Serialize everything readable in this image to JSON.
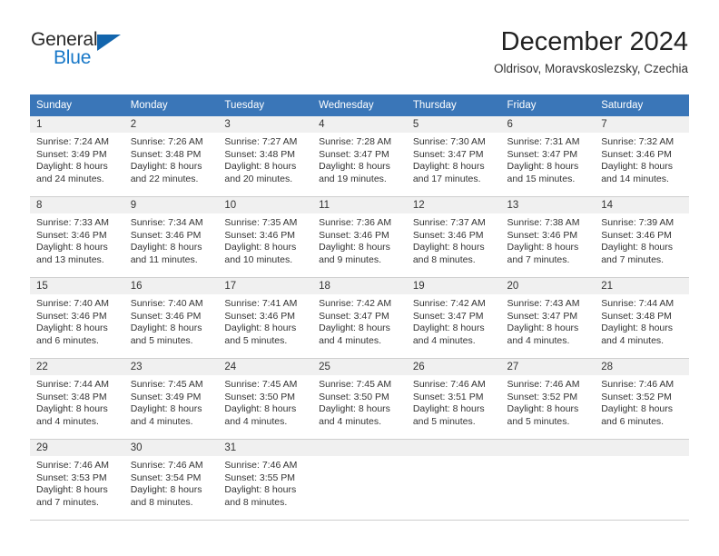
{
  "brand": {
    "name_part1": "General",
    "name_part2": "Blue",
    "triangle_color": "#1265ad",
    "blue_color": "#1878c8"
  },
  "header": {
    "title": "December 2024",
    "location": "Oldrisov, Moravskoslezsky, Czechia"
  },
  "theme": {
    "header_bg": "#3a76b8",
    "header_text": "#ffffff",
    "daynum_bg": "#f0f0f0",
    "body_text": "#333333",
    "border": "#cfcfcf"
  },
  "weekday_headers": [
    "Sunday",
    "Monday",
    "Tuesday",
    "Wednesday",
    "Thursday",
    "Friday",
    "Saturday"
  ],
  "labels": {
    "sunrise_prefix": "Sunrise:",
    "sunset_prefix": "Sunset:",
    "daylight_prefix": "Daylight:"
  },
  "weeks": [
    [
      {
        "day": "1",
        "sunrise": "Sunrise: 7:24 AM",
        "sunset": "Sunset: 3:49 PM",
        "daylight1": "Daylight: 8 hours",
        "daylight2": "and 24 minutes."
      },
      {
        "day": "2",
        "sunrise": "Sunrise: 7:26 AM",
        "sunset": "Sunset: 3:48 PM",
        "daylight1": "Daylight: 8 hours",
        "daylight2": "and 22 minutes."
      },
      {
        "day": "3",
        "sunrise": "Sunrise: 7:27 AM",
        "sunset": "Sunset: 3:48 PM",
        "daylight1": "Daylight: 8 hours",
        "daylight2": "and 20 minutes."
      },
      {
        "day": "4",
        "sunrise": "Sunrise: 7:28 AM",
        "sunset": "Sunset: 3:47 PM",
        "daylight1": "Daylight: 8 hours",
        "daylight2": "and 19 minutes."
      },
      {
        "day": "5",
        "sunrise": "Sunrise: 7:30 AM",
        "sunset": "Sunset: 3:47 PM",
        "daylight1": "Daylight: 8 hours",
        "daylight2": "and 17 minutes."
      },
      {
        "day": "6",
        "sunrise": "Sunrise: 7:31 AM",
        "sunset": "Sunset: 3:47 PM",
        "daylight1": "Daylight: 8 hours",
        "daylight2": "and 15 minutes."
      },
      {
        "day": "7",
        "sunrise": "Sunrise: 7:32 AM",
        "sunset": "Sunset: 3:46 PM",
        "daylight1": "Daylight: 8 hours",
        "daylight2": "and 14 minutes."
      }
    ],
    [
      {
        "day": "8",
        "sunrise": "Sunrise: 7:33 AM",
        "sunset": "Sunset: 3:46 PM",
        "daylight1": "Daylight: 8 hours",
        "daylight2": "and 13 minutes."
      },
      {
        "day": "9",
        "sunrise": "Sunrise: 7:34 AM",
        "sunset": "Sunset: 3:46 PM",
        "daylight1": "Daylight: 8 hours",
        "daylight2": "and 11 minutes."
      },
      {
        "day": "10",
        "sunrise": "Sunrise: 7:35 AM",
        "sunset": "Sunset: 3:46 PM",
        "daylight1": "Daylight: 8 hours",
        "daylight2": "and 10 minutes."
      },
      {
        "day": "11",
        "sunrise": "Sunrise: 7:36 AM",
        "sunset": "Sunset: 3:46 PM",
        "daylight1": "Daylight: 8 hours",
        "daylight2": "and 9 minutes."
      },
      {
        "day": "12",
        "sunrise": "Sunrise: 7:37 AM",
        "sunset": "Sunset: 3:46 PM",
        "daylight1": "Daylight: 8 hours",
        "daylight2": "and 8 minutes."
      },
      {
        "day": "13",
        "sunrise": "Sunrise: 7:38 AM",
        "sunset": "Sunset: 3:46 PM",
        "daylight1": "Daylight: 8 hours",
        "daylight2": "and 7 minutes."
      },
      {
        "day": "14",
        "sunrise": "Sunrise: 7:39 AM",
        "sunset": "Sunset: 3:46 PM",
        "daylight1": "Daylight: 8 hours",
        "daylight2": "and 7 minutes."
      }
    ],
    [
      {
        "day": "15",
        "sunrise": "Sunrise: 7:40 AM",
        "sunset": "Sunset: 3:46 PM",
        "daylight1": "Daylight: 8 hours",
        "daylight2": "and 6 minutes."
      },
      {
        "day": "16",
        "sunrise": "Sunrise: 7:40 AM",
        "sunset": "Sunset: 3:46 PM",
        "daylight1": "Daylight: 8 hours",
        "daylight2": "and 5 minutes."
      },
      {
        "day": "17",
        "sunrise": "Sunrise: 7:41 AM",
        "sunset": "Sunset: 3:46 PM",
        "daylight1": "Daylight: 8 hours",
        "daylight2": "and 5 minutes."
      },
      {
        "day": "18",
        "sunrise": "Sunrise: 7:42 AM",
        "sunset": "Sunset: 3:47 PM",
        "daylight1": "Daylight: 8 hours",
        "daylight2": "and 4 minutes."
      },
      {
        "day": "19",
        "sunrise": "Sunrise: 7:42 AM",
        "sunset": "Sunset: 3:47 PM",
        "daylight1": "Daylight: 8 hours",
        "daylight2": "and 4 minutes."
      },
      {
        "day": "20",
        "sunrise": "Sunrise: 7:43 AM",
        "sunset": "Sunset: 3:47 PM",
        "daylight1": "Daylight: 8 hours",
        "daylight2": "and 4 minutes."
      },
      {
        "day": "21",
        "sunrise": "Sunrise: 7:44 AM",
        "sunset": "Sunset: 3:48 PM",
        "daylight1": "Daylight: 8 hours",
        "daylight2": "and 4 minutes."
      }
    ],
    [
      {
        "day": "22",
        "sunrise": "Sunrise: 7:44 AM",
        "sunset": "Sunset: 3:48 PM",
        "daylight1": "Daylight: 8 hours",
        "daylight2": "and 4 minutes."
      },
      {
        "day": "23",
        "sunrise": "Sunrise: 7:45 AM",
        "sunset": "Sunset: 3:49 PM",
        "daylight1": "Daylight: 8 hours",
        "daylight2": "and 4 minutes."
      },
      {
        "day": "24",
        "sunrise": "Sunrise: 7:45 AM",
        "sunset": "Sunset: 3:50 PM",
        "daylight1": "Daylight: 8 hours",
        "daylight2": "and 4 minutes."
      },
      {
        "day": "25",
        "sunrise": "Sunrise: 7:45 AM",
        "sunset": "Sunset: 3:50 PM",
        "daylight1": "Daylight: 8 hours",
        "daylight2": "and 4 minutes."
      },
      {
        "day": "26",
        "sunrise": "Sunrise: 7:46 AM",
        "sunset": "Sunset: 3:51 PM",
        "daylight1": "Daylight: 8 hours",
        "daylight2": "and 5 minutes."
      },
      {
        "day": "27",
        "sunrise": "Sunrise: 7:46 AM",
        "sunset": "Sunset: 3:52 PM",
        "daylight1": "Daylight: 8 hours",
        "daylight2": "and 5 minutes."
      },
      {
        "day": "28",
        "sunrise": "Sunrise: 7:46 AM",
        "sunset": "Sunset: 3:52 PM",
        "daylight1": "Daylight: 8 hours",
        "daylight2": "and 6 minutes."
      }
    ],
    [
      {
        "day": "29",
        "sunrise": "Sunrise: 7:46 AM",
        "sunset": "Sunset: 3:53 PM",
        "daylight1": "Daylight: 8 hours",
        "daylight2": "and 7 minutes."
      },
      {
        "day": "30",
        "sunrise": "Sunrise: 7:46 AM",
        "sunset": "Sunset: 3:54 PM",
        "daylight1": "Daylight: 8 hours",
        "daylight2": "and 8 minutes."
      },
      {
        "day": "31",
        "sunrise": "Sunrise: 7:46 AM",
        "sunset": "Sunset: 3:55 PM",
        "daylight1": "Daylight: 8 hours",
        "daylight2": "and 8 minutes."
      },
      {
        "day": "",
        "sunrise": "",
        "sunset": "",
        "daylight1": "",
        "daylight2": ""
      },
      {
        "day": "",
        "sunrise": "",
        "sunset": "",
        "daylight1": "",
        "daylight2": ""
      },
      {
        "day": "",
        "sunrise": "",
        "sunset": "",
        "daylight1": "",
        "daylight2": ""
      },
      {
        "day": "",
        "sunrise": "",
        "sunset": "",
        "daylight1": "",
        "daylight2": ""
      }
    ]
  ]
}
